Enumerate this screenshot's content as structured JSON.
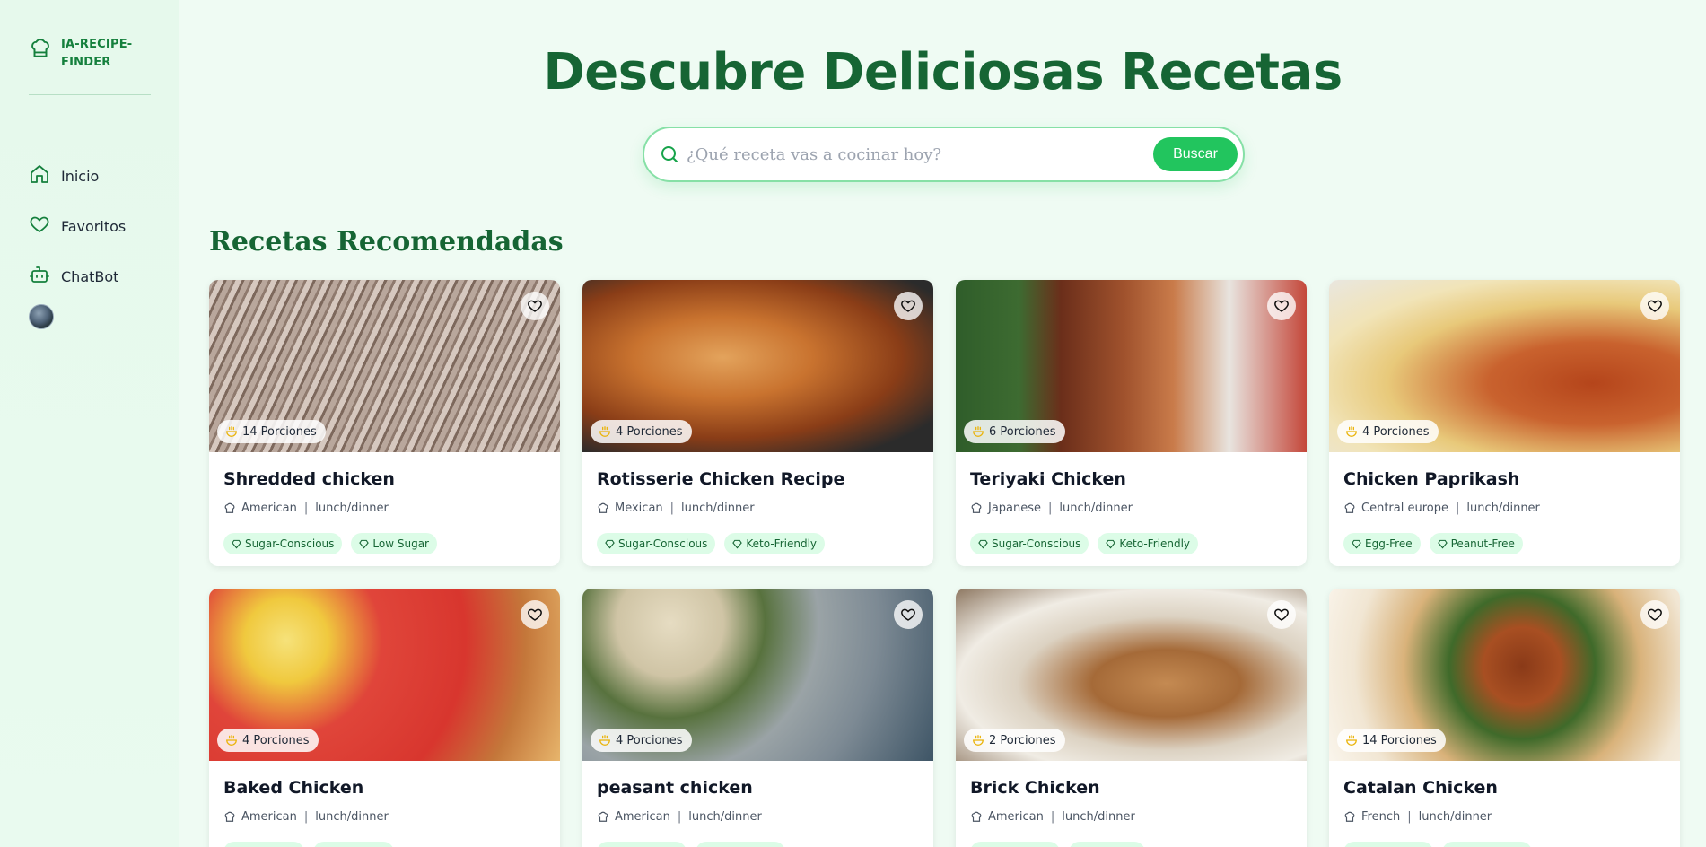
{
  "brand": {
    "line1": "IA-RECIPE-",
    "line2": "FINDER",
    "icon": "chef-hat-icon"
  },
  "nav": [
    {
      "label": "Inicio",
      "icon": "home-icon"
    },
    {
      "label": "Favoritos",
      "icon": "heart-icon"
    },
    {
      "label": "ChatBot",
      "icon": "bot-icon"
    }
  ],
  "header": {
    "title": "Descubre Deliciosas Recetas"
  },
  "search": {
    "placeholder": "¿Qué receta vas a cocinar hoy?",
    "button": "Buscar"
  },
  "section": {
    "title": "Recetas Recomendadas"
  },
  "colors": {
    "accent": "#22c55e",
    "heading": "#166534",
    "tag_bg": "#dcfce7"
  },
  "recipes": [
    {
      "title": "Shredded chicken",
      "servings": "14 Porciones",
      "cuisine": "American",
      "meal": "lunch/dinner",
      "tags": [
        "Sugar-Conscious",
        "Low Sugar"
      ]
    },
    {
      "title": "Rotisserie Chicken Recipe",
      "servings": "4 Porciones",
      "cuisine": "Mexican",
      "meal": "lunch/dinner",
      "tags": [
        "Sugar-Conscious",
        "Keto-Friendly"
      ]
    },
    {
      "title": "Teriyaki Chicken",
      "servings": "6 Porciones",
      "cuisine": "Japanese",
      "meal": "lunch/dinner",
      "tags": [
        "Sugar-Conscious",
        "Keto-Friendly"
      ]
    },
    {
      "title": "Chicken Paprikash",
      "servings": "4 Porciones",
      "cuisine": "Central europe",
      "meal": "lunch/dinner",
      "tags": [
        "Egg-Free",
        "Peanut-Free"
      ]
    },
    {
      "title": "Baked Chicken",
      "servings": "4 Porciones",
      "cuisine": "American",
      "meal": "lunch/dinner",
      "tags": [
        "",
        ""
      ]
    },
    {
      "title": "peasant chicken",
      "servings": "4 Porciones",
      "cuisine": "American",
      "meal": "lunch/dinner",
      "tags": [
        "",
        ""
      ]
    },
    {
      "title": "Brick Chicken",
      "servings": "2 Porciones",
      "cuisine": "American",
      "meal": "lunch/dinner",
      "tags": [
        "",
        ""
      ]
    },
    {
      "title": "Catalan Chicken",
      "servings": "14 Porciones",
      "cuisine": "French",
      "meal": "lunch/dinner",
      "tags": [
        "",
        ""
      ]
    }
  ]
}
